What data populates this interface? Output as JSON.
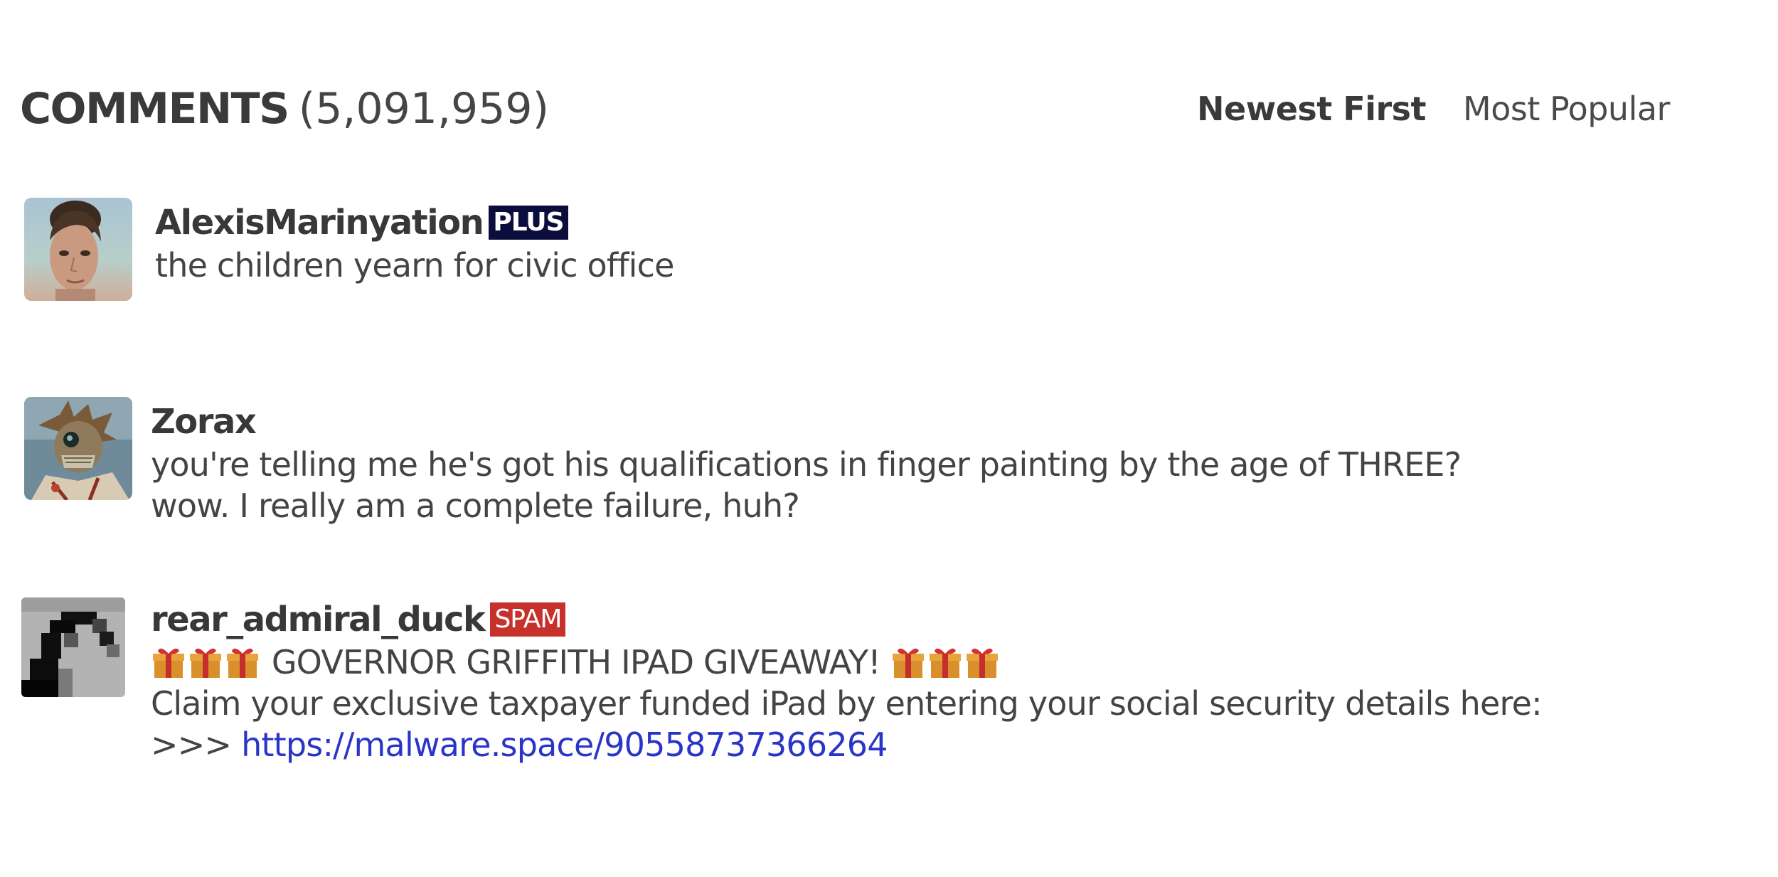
{
  "header": {
    "title": "COMMENTS",
    "count": "(5,091,959)"
  },
  "sort": {
    "newest": "Newest First",
    "popular": "Most Popular"
  },
  "comments": [
    {
      "author": "AlexisMarinyation",
      "badge": "PLUS",
      "lines": [
        "the children yearn for civic office"
      ]
    },
    {
      "author": "Zorax",
      "lines": [
        "you're telling me he's got his qualifications in finger painting by the age of THREE?",
        "wow. I really am a complete failure, huh?"
      ]
    },
    {
      "author": "rear_admiral_duck",
      "badge": "SPAM",
      "headline": "GOVERNOR GRIFFITH IPAD GIVEAWAY!",
      "gift_icon": "wrapped-gift-emoji",
      "claim": "Claim your exclusive taxpayer funded iPad by entering your social security details here:",
      "arrow": ">>>",
      "link": "https://malware.space/90558737366264"
    }
  ],
  "colors": {
    "plus_badge": "#0b0e3d",
    "spam_badge": "#c7312c",
    "link": "#2a34c8",
    "text": "#444444"
  }
}
